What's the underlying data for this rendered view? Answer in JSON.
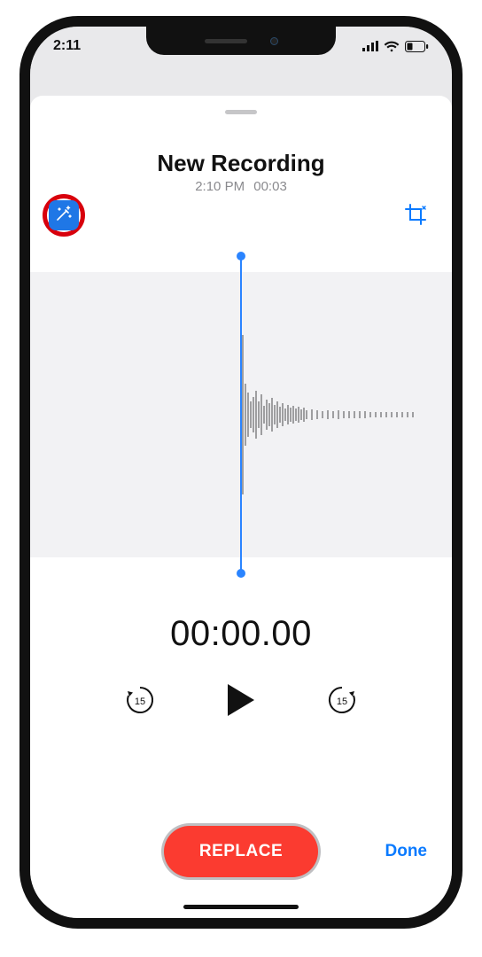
{
  "status": {
    "time": "2:11"
  },
  "header": {
    "title": "New Recording",
    "timestamp": "2:10 PM",
    "duration": "00:03"
  },
  "playback": {
    "current_time": "00:00.00",
    "skip_seconds": "15"
  },
  "actions": {
    "replace_label": "REPLACE",
    "done_label": "Done"
  },
  "colors": {
    "blue": "#0a7aff",
    "red_button": "#fb3b30",
    "highlight_ring": "#d8000c"
  }
}
